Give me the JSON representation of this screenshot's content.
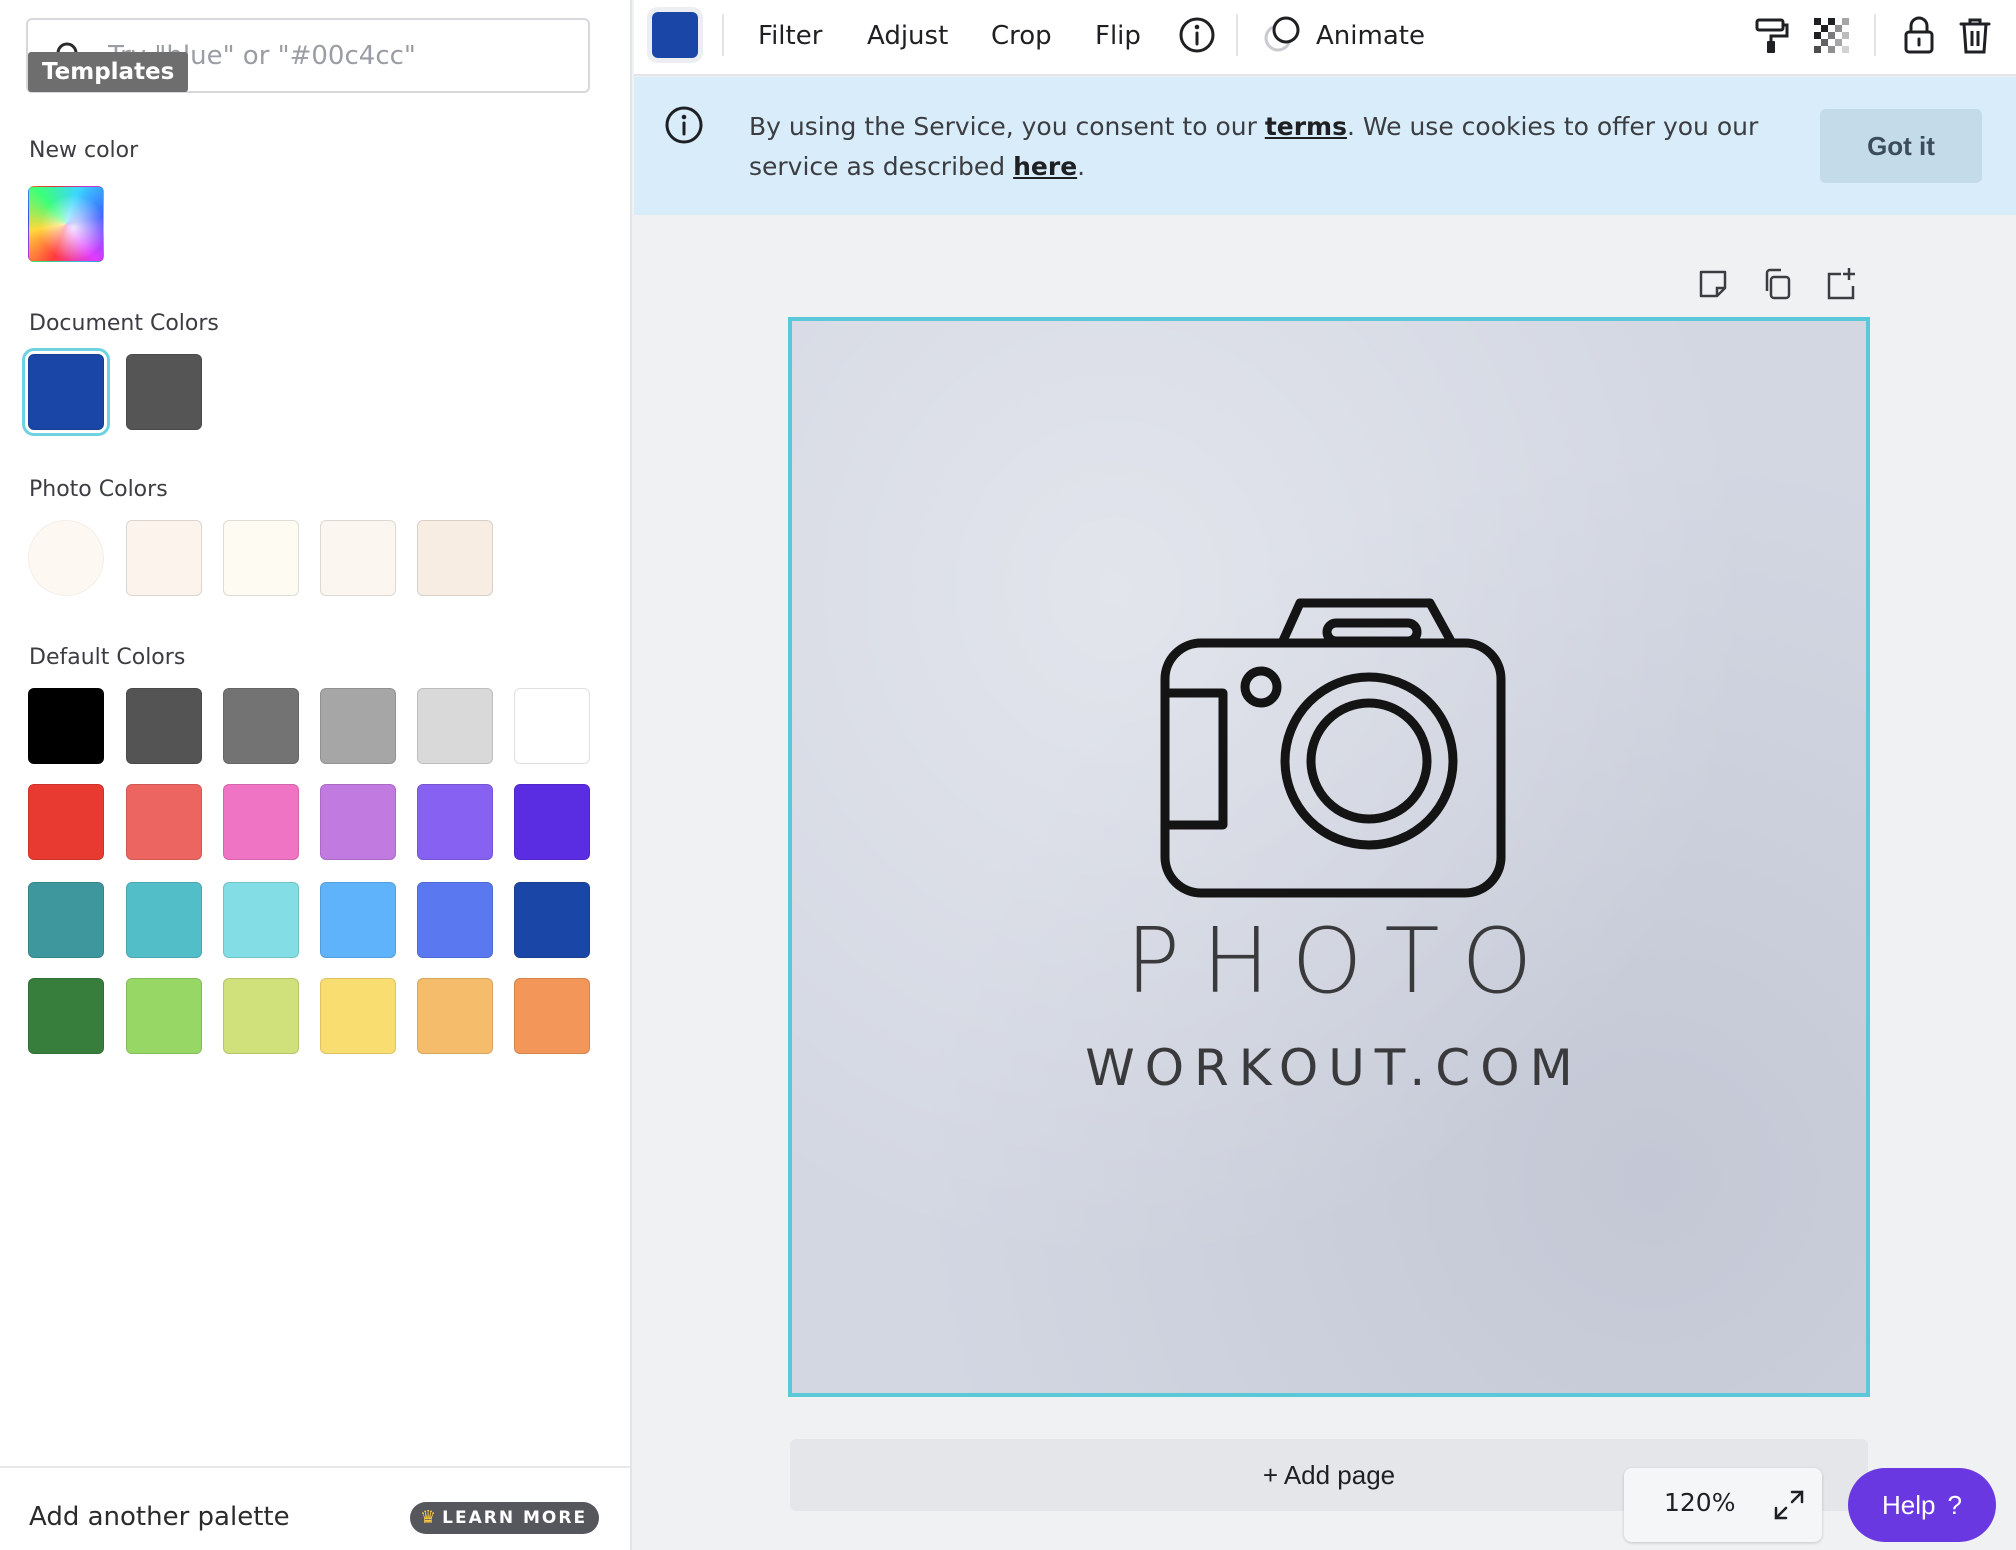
{
  "search": {
    "placeholder": "Try \"blue\" or \"#00c4cc\""
  },
  "tooltip": {
    "templates": "Templates"
  },
  "panel": {
    "new_color_title": "New color",
    "document_colors_title": "Document Colors",
    "document_colors": [
      "#1a47a7",
      "#555555"
    ],
    "photo_colors_title": "Photo Colors",
    "photo_colors": [
      "#fdf8f1",
      "#fcf3ec",
      "#fefbf3",
      "#fbf7f0",
      "#f7ede3"
    ],
    "default_colors_title": "Default Colors",
    "default_colors": [
      [
        "#000000",
        "#545454",
        "#737373",
        "#a6a6a6",
        "#d9d9d9",
        "#ffffff"
      ],
      [
        "#e83a30",
        "#ec6560",
        "#f074c4",
        "#c17ae0",
        "#8661f2",
        "#5a2de3"
      ],
      [
        "#3f979e",
        "#52bec8",
        "#82dde4",
        "#5fb3fa",
        "#5a78f0",
        "#1a47a7"
      ],
      [
        "#377e3d",
        "#96d766",
        "#d0e07a",
        "#fadd70",
        "#f5bd6b",
        "#f2965a"
      ]
    ],
    "add_palette_label": "Add another palette",
    "learn_more_label": "LEARN MORE"
  },
  "toolbar": {
    "selected_color": "#1a47a7",
    "filter_label": "Filter",
    "adjust_label": "Adjust",
    "crop_label": "Crop",
    "flip_label": "Flip",
    "animate_label": "Animate"
  },
  "cookie_banner": {
    "text_before_terms": "By using the Service, you consent to our ",
    "terms_link": "terms",
    "text_middle": ". We use cookies to offer you our service as described ",
    "here_link": "here",
    "text_end": ".",
    "got_it_label": "Got it"
  },
  "canvas": {
    "logo_title": "PHOTO",
    "logo_subtitle": "WORKOUT.COM",
    "add_page_label": "+ Add page",
    "accent_border": "#5ac8d8"
  },
  "zoom": {
    "level": "120%"
  },
  "help": {
    "label": "Help",
    "icon": "?"
  }
}
